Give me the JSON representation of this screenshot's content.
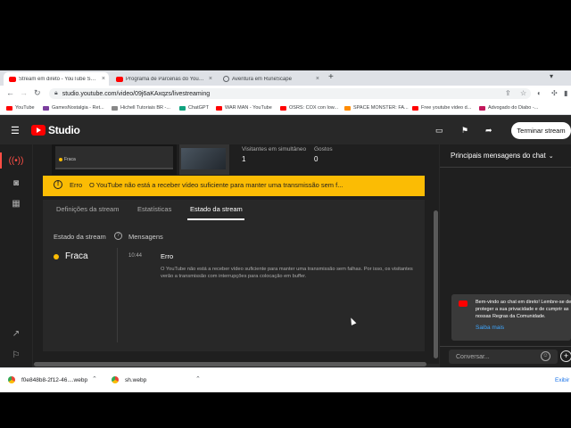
{
  "browser": {
    "tabs": [
      {
        "title": "Stream em direto - YouTube Studio",
        "close": "×",
        "active": true
      },
      {
        "title": "Programa de Parcerias do YouTube",
        "close": "×",
        "active": false
      },
      {
        "title": "Aventura em RuneScape",
        "close": "×",
        "active": false
      }
    ],
    "new_tab": "+",
    "url": "studio.youtube.com/video/09j6aKAxqzs/livestreaming",
    "bookmarks": [
      {
        "label": "YouTube",
        "color": "#ff0000"
      },
      {
        "label": "GamesNostalgia - Ret...",
        "color": "#7b3f9e"
      },
      {
        "label": "Hichell Tutoriais BR -...",
        "color": "#888888"
      },
      {
        "label": "ChatGPT",
        "color": "#10a37f"
      },
      {
        "label": "WAR MAN - YouTube",
        "color": "#ff0000"
      },
      {
        "label": "OSRS: COX con low...",
        "color": "#ff0000"
      },
      {
        "label": "SPACE MONSTER: FA...",
        "color": "#ff8c00"
      },
      {
        "label": "Free youtube video d...",
        "color": "#ff0000"
      },
      {
        "label": "Advogado do Diabo -...",
        "color": "#c2185b"
      }
    ]
  },
  "studio": {
    "logo_text": "Studio",
    "end_stream_label": "Terminar stream",
    "stats": [
      {
        "label": "Visitantes em simultâneo",
        "value": "1"
      },
      {
        "label": "Gostos",
        "value": "0"
      }
    ],
    "preview_quality": "Fraca",
    "error": {
      "title": "Erro",
      "message": "O YouTube não está a receber vídeo suficiente para manter uma transmissão sem f..."
    },
    "tabs": [
      {
        "label": "Definições da stream",
        "active": false
      },
      {
        "label": "Estatísticas",
        "active": false
      },
      {
        "label": "Estado da stream",
        "active": true
      }
    ],
    "status_header": "Estado da stream",
    "help_icon": "?",
    "messages_header": "Mensagens",
    "status_value": "Fraca",
    "status_color": "#fbbc04",
    "message": {
      "time": "10:44",
      "title": "Erro",
      "body": "O YouTube não está a receber vídeo suficiente para manter uma transmissão sem falhas. Por isso, os visitantes verão a transmissão com interrupções para colocação em buffer."
    }
  },
  "chat": {
    "header": "Principais mensagens do chat",
    "welcome": "Bem-vindo ao chat em direto! Lembre-se de proteger a sua privacidade e de cumprir as nossas Regras da Comunidade.",
    "learn_more": "Saiba mais",
    "input_placeholder": "Conversar..."
  },
  "downloads": {
    "items": [
      "f0e848b8-2f12-46....webp",
      "sh.webp"
    ],
    "show_all": "Exibir"
  }
}
